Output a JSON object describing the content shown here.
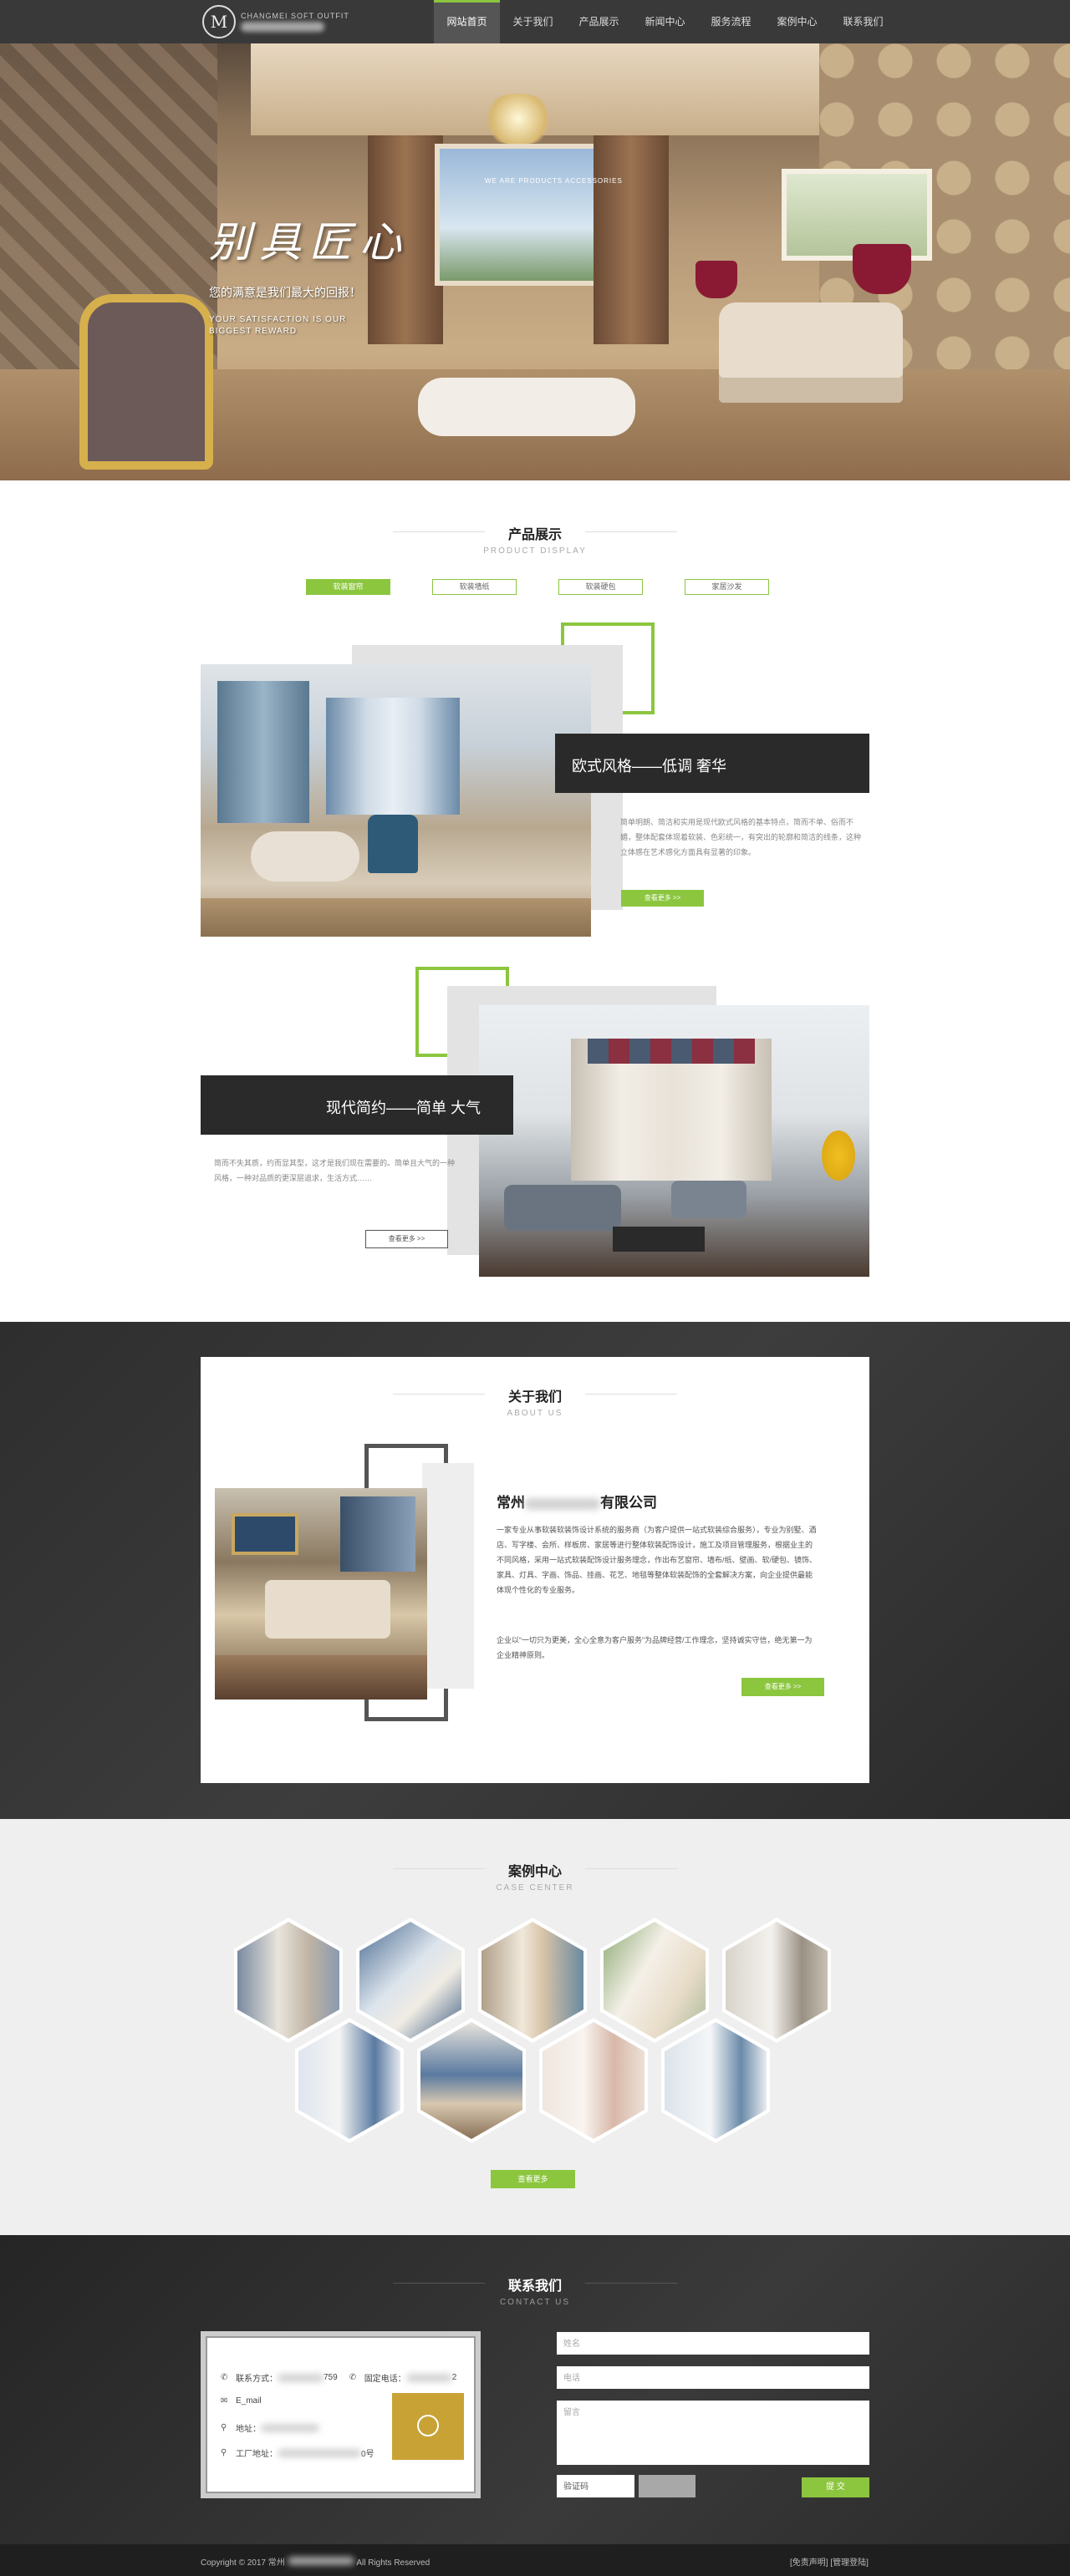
{
  "nav": {
    "logo_letter": "M",
    "brand_en": "CHANGMEI SOFT OUTFIT",
    "items": [
      {
        "label": "网站首页",
        "active": true
      },
      {
        "label": "关于我们",
        "active": false
      },
      {
        "label": "产品展示",
        "active": false
      },
      {
        "label": "新闻中心",
        "active": false
      },
      {
        "label": "服务流程",
        "active": false
      },
      {
        "label": "案例中心",
        "active": false
      },
      {
        "label": "联系我们",
        "active": false
      }
    ]
  },
  "hero": {
    "title": "别具匠心",
    "subtitle": "您的满意是我们最大的回报！",
    "subtitle_en": "YOUR SATISFACTION IS OUR BIGGEST REWARD",
    "top_en": "WE ARE PRODUCTS ACCESSORIES"
  },
  "products": {
    "title": "产品展示",
    "title_en": "PRODUCT DISPLAY",
    "tabs": [
      "软装窗帘",
      "软装墙纸",
      "软装硬包",
      "家居沙发"
    ],
    "item1": {
      "title": "欧式风格——低调 奢华",
      "desc": "简单明朗、简洁和实用是现代欧式风格的基本特点，简而不单、俗而不媚，整体配套体现着软装、色彩统一，有突出的轮廓和简洁的线条，这种立体感在艺术感化方面具有显著的印象。",
      "button": "查看更多 >>"
    },
    "item2": {
      "title": "现代简约——简单 大气",
      "desc": "简而不失其质，约而显其型，这才是我们现在需要的。简单且大气的一种风格，一种对品质的更深层追求，生活方式……",
      "button": "查看更多 >>"
    }
  },
  "about": {
    "title": "关于我们",
    "title_en": "ABOUT US",
    "company_prefix": "常州",
    "company_suffix": "有限公司",
    "text1": "一家专业从事软装软装饰设计系统的服务商（为客户提供一站式软装综合服务），专业为别墅、酒店、写字楼、会所、样板房、家居等进行整体软装配饰设计，施工及项目管理服务，根据业主的不同风格，采用一站式软装配饰设计服务理念，作出布艺窗帘、墙布/纸、壁画、软/硬包、镜饰、家具、灯具、字画、饰品、挂画、花艺、地毯等整体软装配饰的全套解决方案，向企业提供最能体现个性化的专业服务。",
    "text2": "企业以“一切只为更美，全心全意为客户服务”为品牌经营/工作理念，坚持诚实守信，绝无第一为企业精神原则。",
    "button": "查看更多 >>"
  },
  "cases": {
    "title": "案例中心",
    "title_en": "CASE CENTER",
    "button": "查看更多"
  },
  "contact": {
    "title": "联系我们",
    "title_en": "CONTACT US",
    "phone_label": "联系方式：",
    "phone_tail": "759",
    "landline_label": "固定电话：",
    "landline_tail": "2",
    "email_label": "E_mail",
    "address_label": "地址：",
    "factory_label": "工厂地址：",
    "factory_tail": "0号",
    "name_placeholder": "姓名",
    "tel_placeholder": "电话",
    "msg_placeholder": "留言",
    "captcha_label": "验证码",
    "submit": "提 交"
  },
  "footer": {
    "copyright_prefix": "Copyright  © 2017  常州",
    "copyright_suffix": "All Rights Reserved",
    "links": "[免责声明] [管理登陆]"
  },
  "colors": {
    "accent": "#8cc63f",
    "dark": "#2a2a2a"
  }
}
